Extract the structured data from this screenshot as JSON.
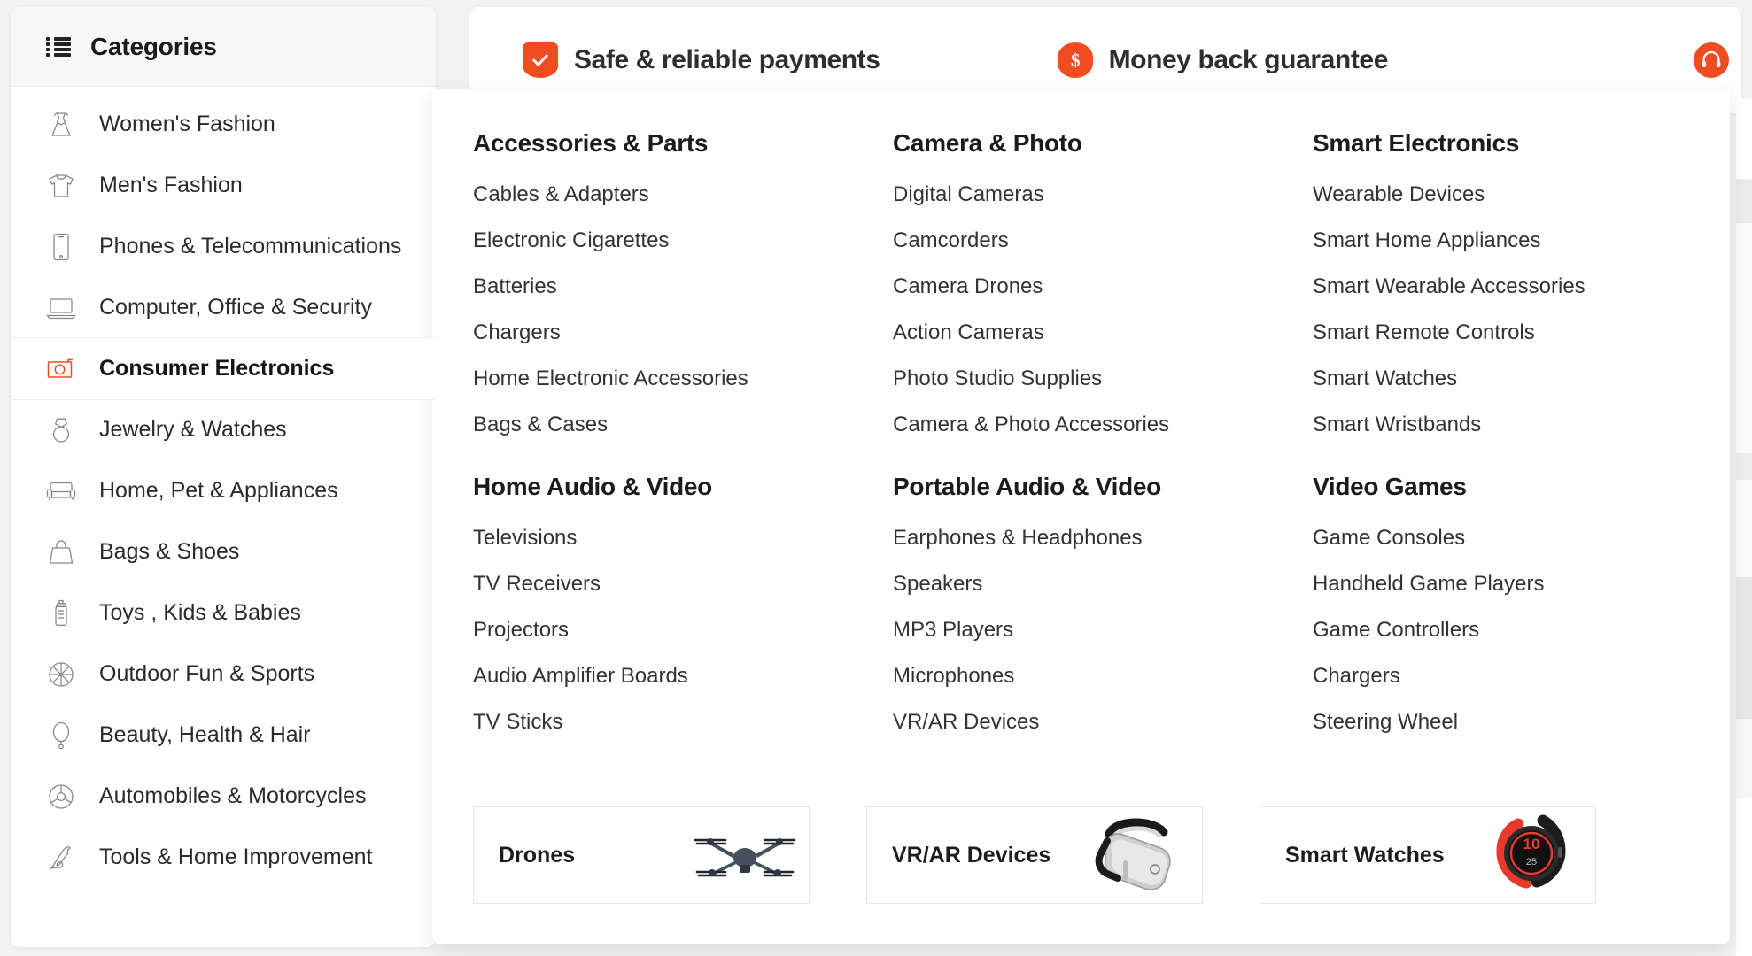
{
  "sidebar": {
    "header": {
      "title": "Categories",
      "icon": "list-icon"
    },
    "items": [
      {
        "label": "Women's Fashion",
        "icon": "dress-icon",
        "active": false
      },
      {
        "label": "Men's Fashion",
        "icon": "tshirt-icon",
        "active": false
      },
      {
        "label": "Phones & Telecommunications",
        "icon": "phone-icon",
        "active": false
      },
      {
        "label": "Computer, Office & Security",
        "icon": "laptop-icon",
        "active": false
      },
      {
        "label": "Consumer Electronics",
        "icon": "camera-icon",
        "active": true
      },
      {
        "label": "Jewelry & Watches",
        "icon": "ring-icon",
        "active": false
      },
      {
        "label": "Home, Pet & Appliances",
        "icon": "sofa-icon",
        "active": false
      },
      {
        "label": "Bags & Shoes",
        "icon": "handbag-icon",
        "active": false
      },
      {
        "label": "Toys , Kids & Babies",
        "icon": "baby-bottle-icon",
        "active": false
      },
      {
        "label": "Outdoor Fun & Sports",
        "icon": "basketball-icon",
        "active": false
      },
      {
        "label": "Beauty, Health & Hair",
        "icon": "mirror-icon",
        "active": false
      },
      {
        "label": "Automobiles & Motorcycles",
        "icon": "steering-wheel-icon",
        "active": false
      },
      {
        "label": "Tools & Home Improvement",
        "icon": "tool-icon",
        "active": false
      }
    ]
  },
  "trustbar": {
    "items": [
      {
        "label": "Safe & reliable payments",
        "icon": "shield-check-icon"
      },
      {
        "label": "Money back guarantee",
        "icon": "dollar-coin-icon"
      },
      {
        "label": "",
        "icon": "headset-support-icon"
      }
    ]
  },
  "megapanel": {
    "columns": [
      {
        "groups": [
          {
            "title": "Accessories & Parts",
            "links": [
              "Cables & Adapters",
              "Electronic Cigarettes",
              "Batteries",
              "Chargers",
              "Home Electronic Accessories",
              "Bags & Cases"
            ]
          },
          {
            "title": "Home Audio & Video",
            "links": [
              "Televisions",
              "TV Receivers",
              "Projectors",
              "Audio Amplifier Boards",
              "TV Sticks"
            ]
          }
        ]
      },
      {
        "groups": [
          {
            "title": "Camera & Photo",
            "links": [
              "Digital Cameras",
              "Camcorders",
              "Camera Drones",
              "Action Cameras",
              "Photo Studio Supplies",
              "Camera & Photo Accessories"
            ]
          },
          {
            "title": "Portable Audio & Video",
            "links": [
              "Earphones & Headphones",
              "Speakers",
              "MP3 Players",
              "Microphones",
              "VR/AR Devices"
            ]
          }
        ]
      },
      {
        "groups": [
          {
            "title": "Smart Electronics",
            "links": [
              "Wearable Devices",
              "Smart Home Appliances",
              "Smart Wearable Accessories",
              "Smart Remote Controls",
              "Smart Watches",
              "Smart Wristbands"
            ]
          },
          {
            "title": "Video Games",
            "links": [
              "Game Consoles",
              "Handheld Game Players",
              "Game Controllers",
              "Chargers",
              "Steering Wheel"
            ]
          }
        ]
      }
    ],
    "promos": [
      {
        "title": "Drones",
        "image": "drone-photo"
      },
      {
        "title": "VR/AR Devices",
        "image": "vr-headset-photo"
      },
      {
        "title": "Smart Watches",
        "image": "smartwatch-photo"
      }
    ]
  },
  "colors": {
    "accent": "#ef4c22",
    "text": "#2b2b2b",
    "heading": "#1c1c1c",
    "panel_bg": "#ffffff",
    "page_bg": "#f2f2f2"
  }
}
